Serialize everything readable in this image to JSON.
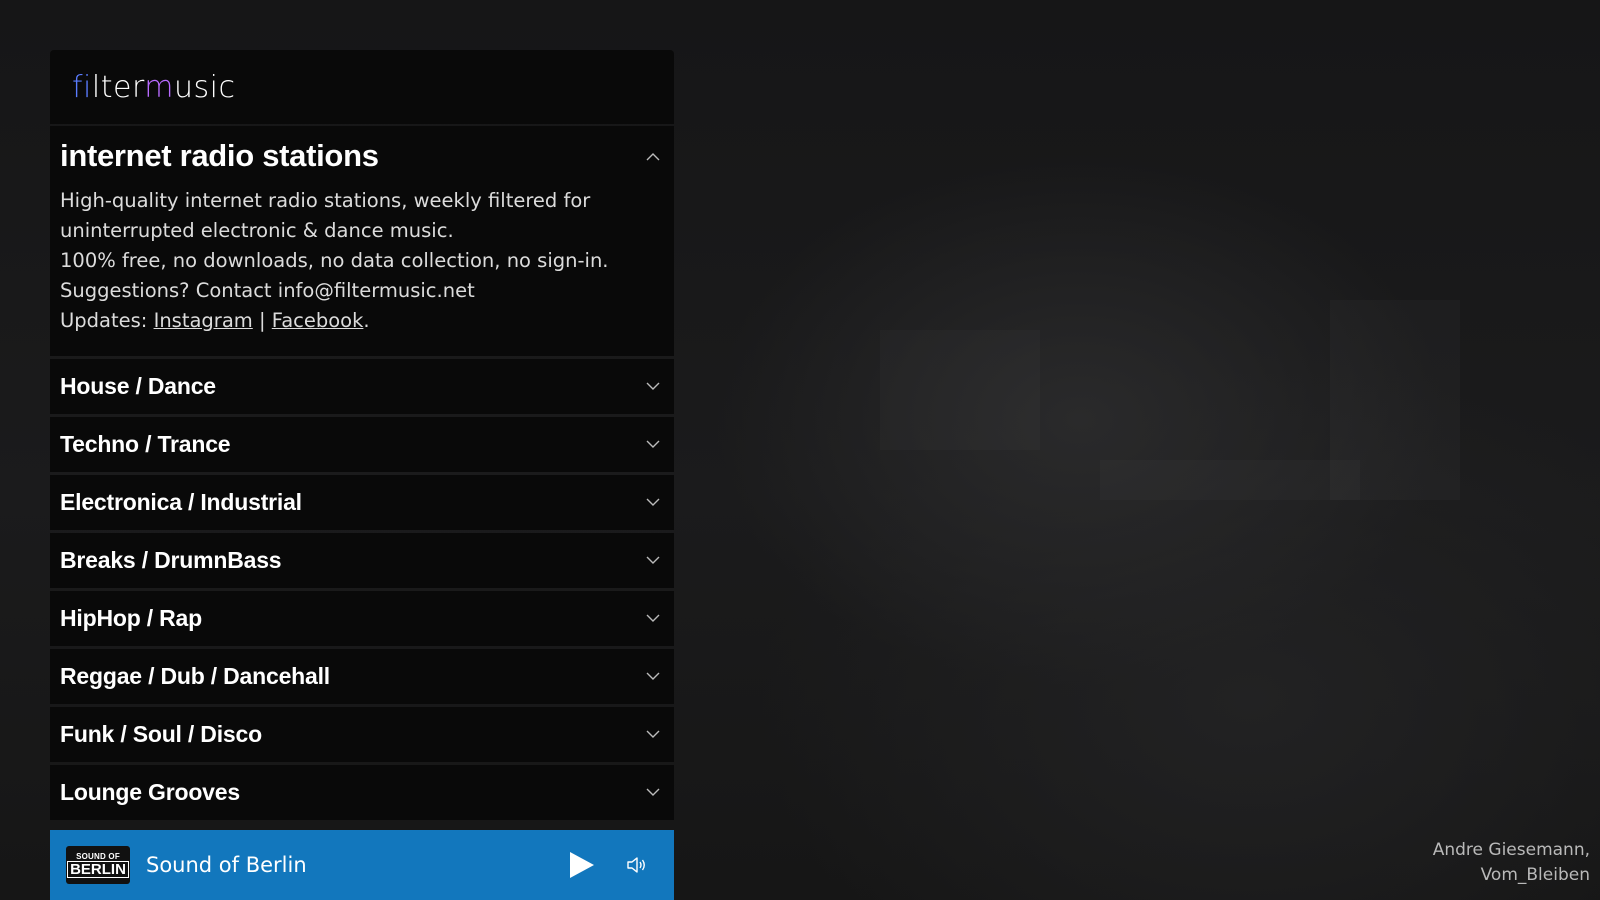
{
  "brand": {
    "part1": "fi",
    "part2": "lter",
    "part3": "m",
    "part4": "usic"
  },
  "intro": {
    "title": "internet radio stations",
    "line1": "High-quality internet radio stations, weekly filtered for",
    "line2": "uninterrupted electronic & dance music.",
    "line3": "100% free, no downloads, no data collection, no sign-in.",
    "line4": "Suggestions? Contact info@filtermusic.net",
    "updates_label": "Updates:",
    "link_instagram": "Instagram",
    "separator": "|",
    "link_facebook": "Facebook",
    "period": "."
  },
  "categories": [
    {
      "label": "House / Dance"
    },
    {
      "label": "Techno / Trance"
    },
    {
      "label": "Electronica / Industrial"
    },
    {
      "label": "Breaks / DrumnBass"
    },
    {
      "label": "HipHop / Rap"
    },
    {
      "label": "Reggae / Dub / Dancehall"
    },
    {
      "label": "Funk / Soul / Disco"
    },
    {
      "label": "Lounge Grooves"
    }
  ],
  "player": {
    "logo_line1": "SOUND OF",
    "logo_line2": "BERLIN",
    "station": "Sound of Berlin",
    "play_icon": "play-icon",
    "volume_icon": "volume-icon",
    "accent": "#1277bd"
  },
  "credit": {
    "line1": "Andre Giesemann,",
    "line2": "Vom_Bleiben"
  }
}
